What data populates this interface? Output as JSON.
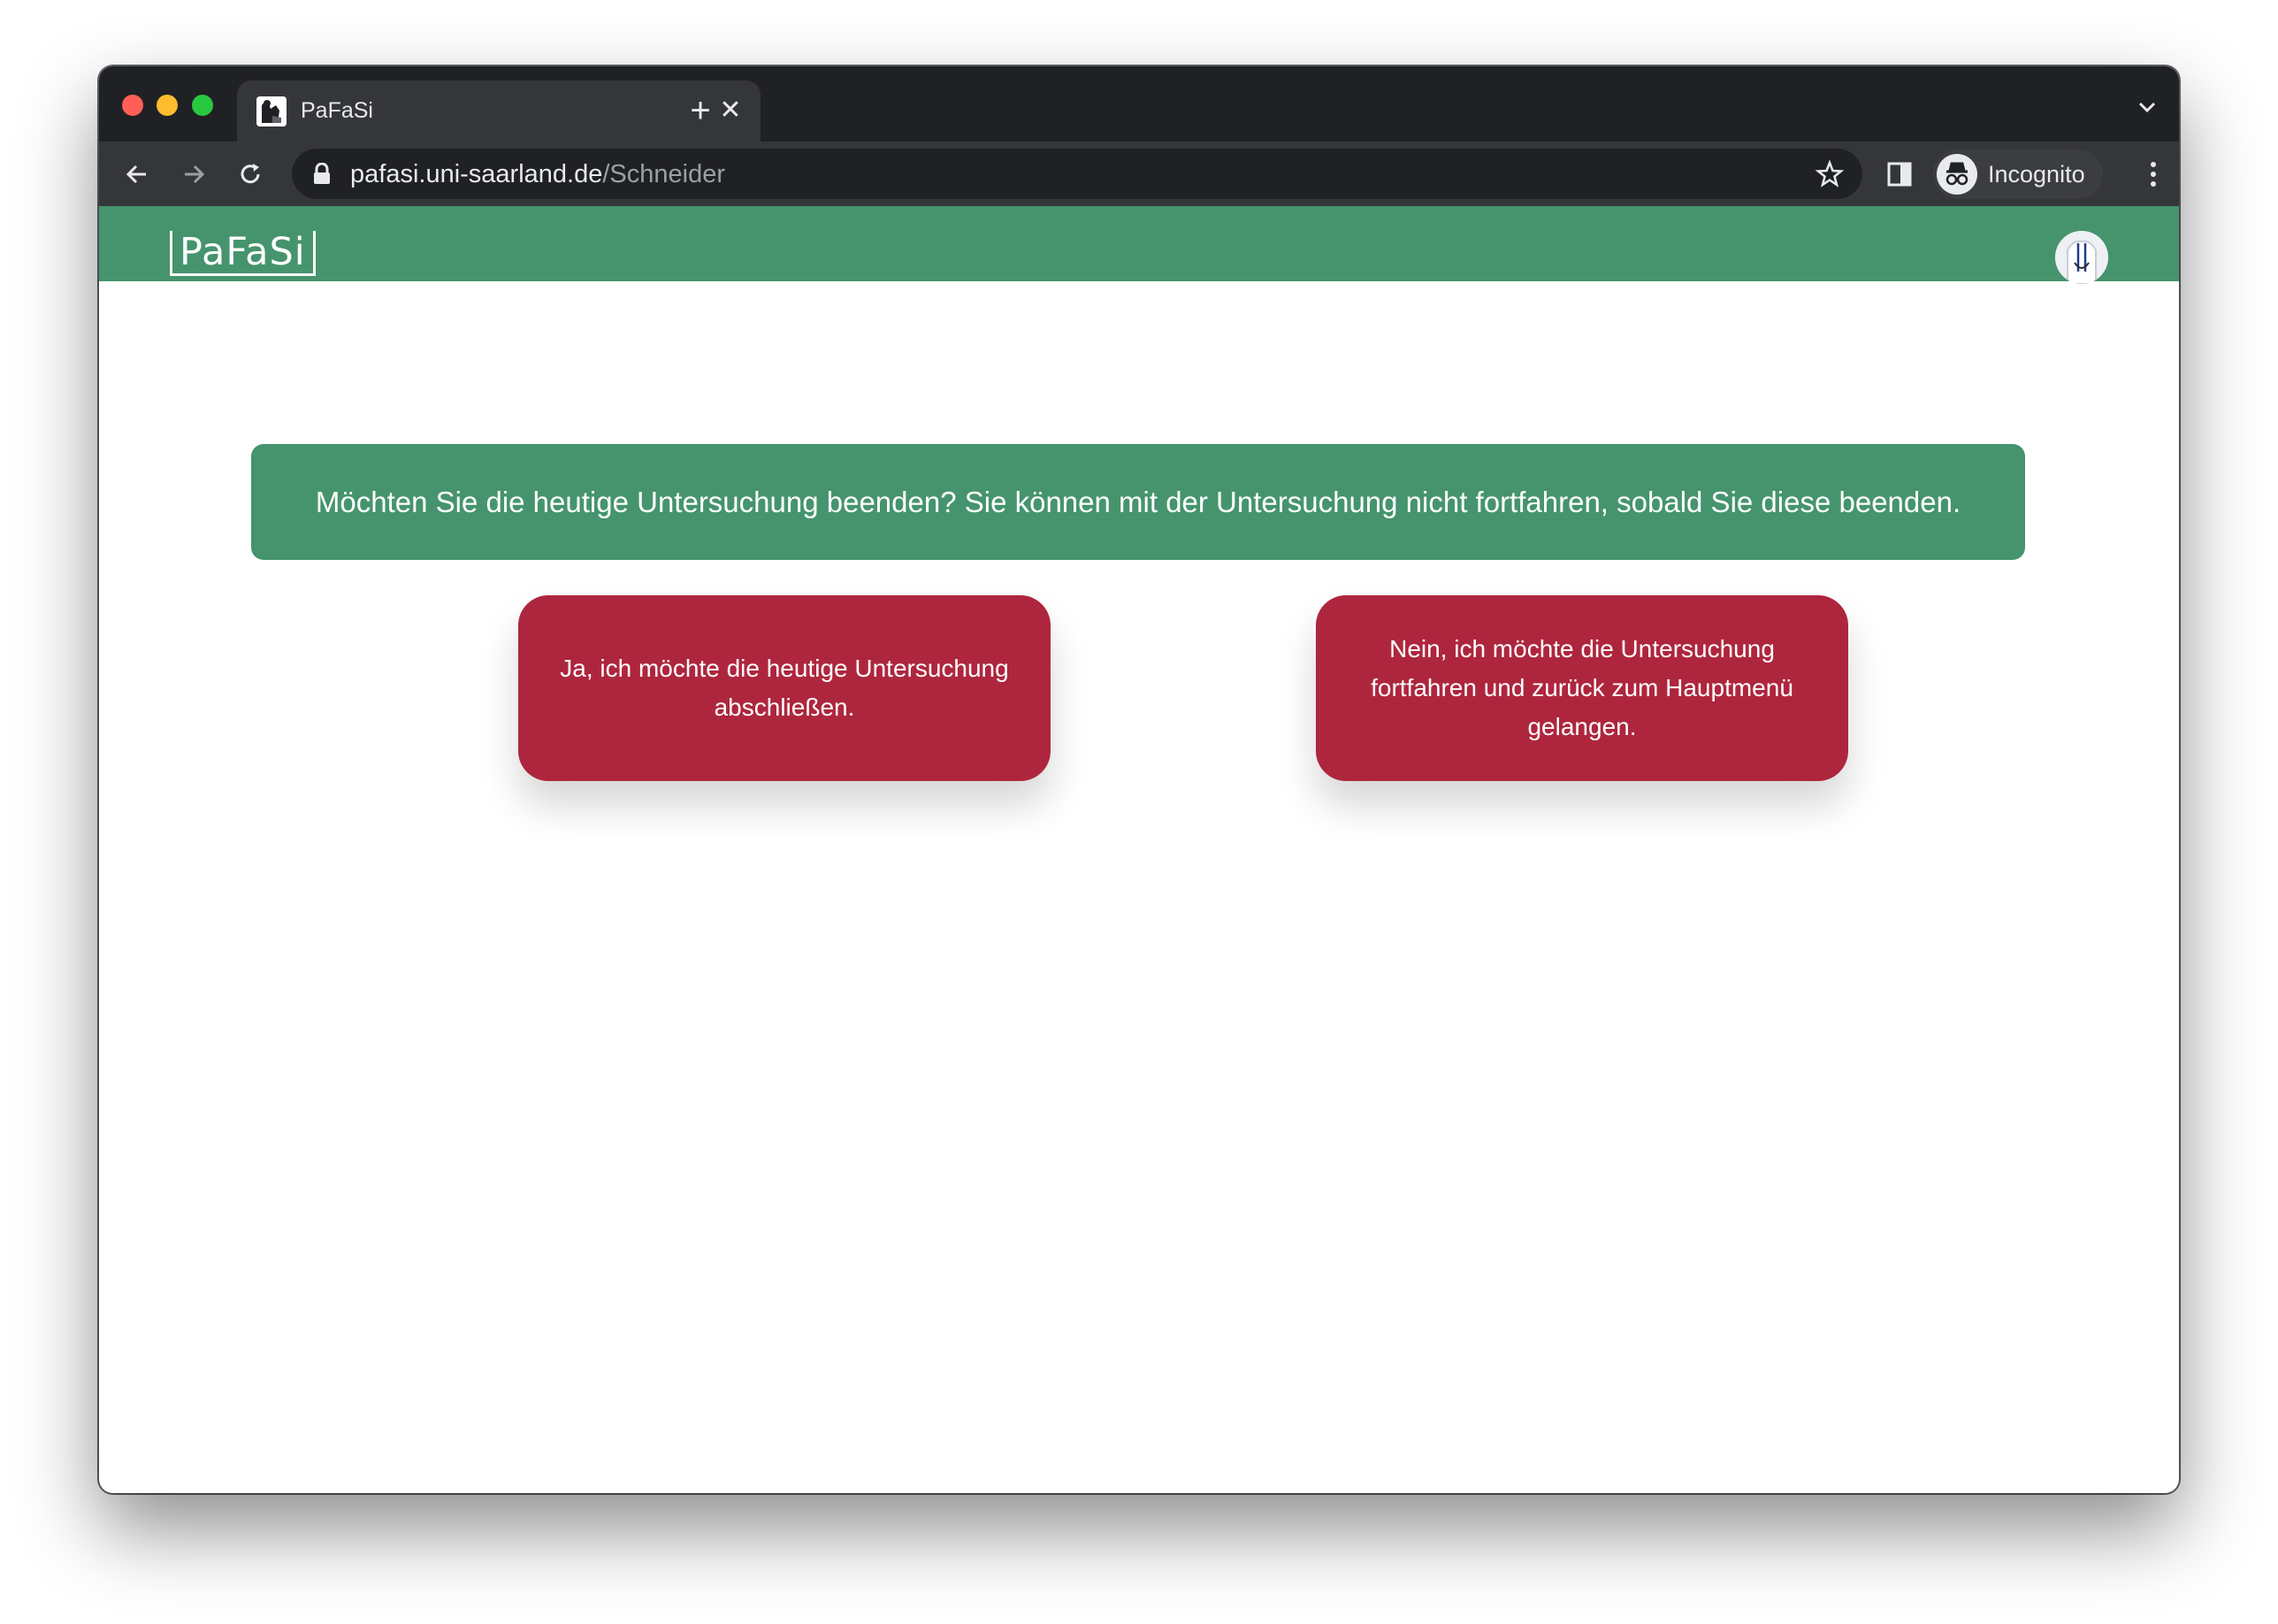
{
  "browser": {
    "tab_title": "PaFaSi",
    "url_host": "pafasi.uni-saarland.de",
    "url_path": "/Schneider",
    "profile_label": "Incognito",
    "icons": [
      "back-arrow-icon",
      "forward-arrow-icon",
      "reload-icon",
      "lock-icon",
      "star-icon",
      "side-panel-icon",
      "incognito-icon",
      "kebab-menu-icon",
      "close-icon",
      "plus-icon",
      "chevron-down-icon"
    ]
  },
  "app": {
    "logo": "PaFaSi",
    "header_color": "#45946d"
  },
  "main": {
    "message": "Möchten Sie die heutige Untersuchung beenden? Sie können mit der Untersuchung nicht fortfahren, sobald Sie diese beenden.",
    "confirm_button": "Ja, ich möchte die heutige Untersuchung abschließen.",
    "cancel_button": "Nein, ich möchte die Untersuchung fortfahren und zurück zum Hauptmenü gelangen.",
    "button_color": "#ae263d"
  }
}
